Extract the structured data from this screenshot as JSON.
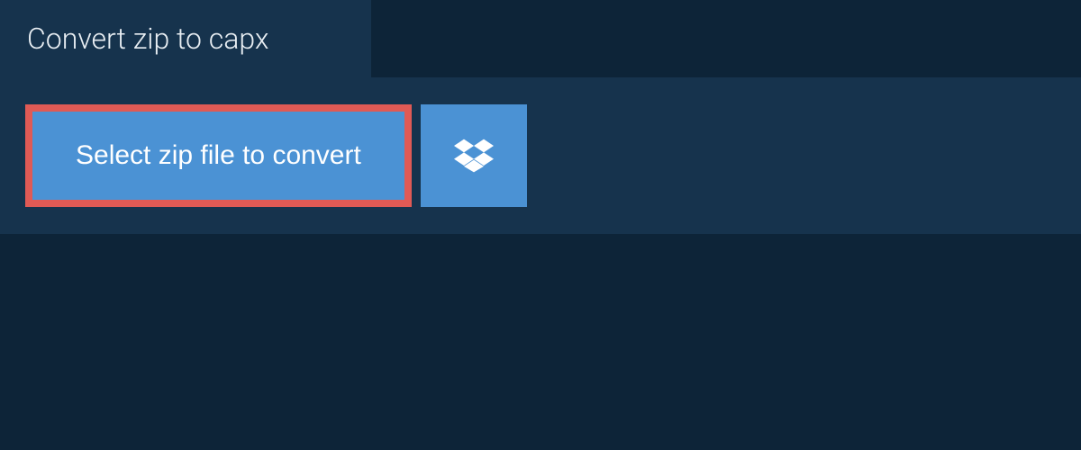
{
  "header": {
    "title": "Convert zip to capx"
  },
  "actions": {
    "select_file_label": "Select zip file to convert",
    "dropbox_icon": "dropbox-icon"
  },
  "colors": {
    "background": "#0d2438",
    "panel": "#16334d",
    "button_primary": "#4b92d4",
    "highlight_border": "#e05a55",
    "text_light": "#ffffff"
  }
}
